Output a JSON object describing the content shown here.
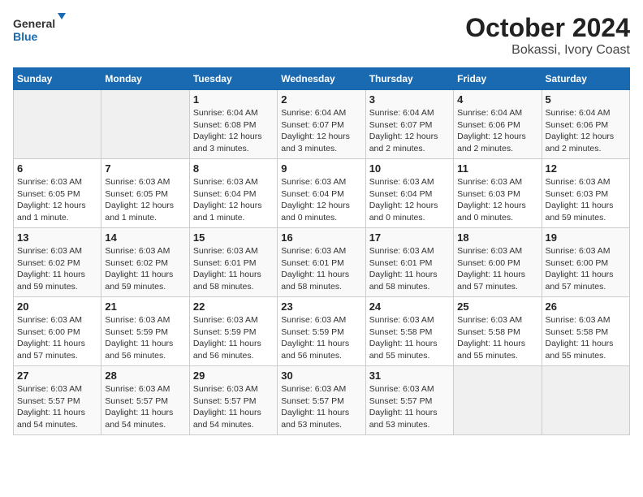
{
  "logo": {
    "text_general": "General",
    "text_blue": "Blue"
  },
  "title": "October 2024",
  "subtitle": "Bokassi, Ivory Coast",
  "header_days": [
    "Sunday",
    "Monday",
    "Tuesday",
    "Wednesday",
    "Thursday",
    "Friday",
    "Saturday"
  ],
  "weeks": [
    [
      {
        "day": "",
        "info": ""
      },
      {
        "day": "",
        "info": ""
      },
      {
        "day": "1",
        "info": "Sunrise: 6:04 AM\nSunset: 6:08 PM\nDaylight: 12 hours\nand 3 minutes."
      },
      {
        "day": "2",
        "info": "Sunrise: 6:04 AM\nSunset: 6:07 PM\nDaylight: 12 hours\nand 3 minutes."
      },
      {
        "day": "3",
        "info": "Sunrise: 6:04 AM\nSunset: 6:07 PM\nDaylight: 12 hours\nand 2 minutes."
      },
      {
        "day": "4",
        "info": "Sunrise: 6:04 AM\nSunset: 6:06 PM\nDaylight: 12 hours\nand 2 minutes."
      },
      {
        "day": "5",
        "info": "Sunrise: 6:04 AM\nSunset: 6:06 PM\nDaylight: 12 hours\nand 2 minutes."
      }
    ],
    [
      {
        "day": "6",
        "info": "Sunrise: 6:03 AM\nSunset: 6:05 PM\nDaylight: 12 hours\nand 1 minute."
      },
      {
        "day": "7",
        "info": "Sunrise: 6:03 AM\nSunset: 6:05 PM\nDaylight: 12 hours\nand 1 minute."
      },
      {
        "day": "8",
        "info": "Sunrise: 6:03 AM\nSunset: 6:04 PM\nDaylight: 12 hours\nand 1 minute."
      },
      {
        "day": "9",
        "info": "Sunrise: 6:03 AM\nSunset: 6:04 PM\nDaylight: 12 hours\nand 0 minutes."
      },
      {
        "day": "10",
        "info": "Sunrise: 6:03 AM\nSunset: 6:04 PM\nDaylight: 12 hours\nand 0 minutes."
      },
      {
        "day": "11",
        "info": "Sunrise: 6:03 AM\nSunset: 6:03 PM\nDaylight: 12 hours\nand 0 minutes."
      },
      {
        "day": "12",
        "info": "Sunrise: 6:03 AM\nSunset: 6:03 PM\nDaylight: 11 hours\nand 59 minutes."
      }
    ],
    [
      {
        "day": "13",
        "info": "Sunrise: 6:03 AM\nSunset: 6:02 PM\nDaylight: 11 hours\nand 59 minutes."
      },
      {
        "day": "14",
        "info": "Sunrise: 6:03 AM\nSunset: 6:02 PM\nDaylight: 11 hours\nand 59 minutes."
      },
      {
        "day": "15",
        "info": "Sunrise: 6:03 AM\nSunset: 6:01 PM\nDaylight: 11 hours\nand 58 minutes."
      },
      {
        "day": "16",
        "info": "Sunrise: 6:03 AM\nSunset: 6:01 PM\nDaylight: 11 hours\nand 58 minutes."
      },
      {
        "day": "17",
        "info": "Sunrise: 6:03 AM\nSunset: 6:01 PM\nDaylight: 11 hours\nand 58 minutes."
      },
      {
        "day": "18",
        "info": "Sunrise: 6:03 AM\nSunset: 6:00 PM\nDaylight: 11 hours\nand 57 minutes."
      },
      {
        "day": "19",
        "info": "Sunrise: 6:03 AM\nSunset: 6:00 PM\nDaylight: 11 hours\nand 57 minutes."
      }
    ],
    [
      {
        "day": "20",
        "info": "Sunrise: 6:03 AM\nSunset: 6:00 PM\nDaylight: 11 hours\nand 57 minutes."
      },
      {
        "day": "21",
        "info": "Sunrise: 6:03 AM\nSunset: 5:59 PM\nDaylight: 11 hours\nand 56 minutes."
      },
      {
        "day": "22",
        "info": "Sunrise: 6:03 AM\nSunset: 5:59 PM\nDaylight: 11 hours\nand 56 minutes."
      },
      {
        "day": "23",
        "info": "Sunrise: 6:03 AM\nSunset: 5:59 PM\nDaylight: 11 hours\nand 56 minutes."
      },
      {
        "day": "24",
        "info": "Sunrise: 6:03 AM\nSunset: 5:58 PM\nDaylight: 11 hours\nand 55 minutes."
      },
      {
        "day": "25",
        "info": "Sunrise: 6:03 AM\nSunset: 5:58 PM\nDaylight: 11 hours\nand 55 minutes."
      },
      {
        "day": "26",
        "info": "Sunrise: 6:03 AM\nSunset: 5:58 PM\nDaylight: 11 hours\nand 55 minutes."
      }
    ],
    [
      {
        "day": "27",
        "info": "Sunrise: 6:03 AM\nSunset: 5:57 PM\nDaylight: 11 hours\nand 54 minutes."
      },
      {
        "day": "28",
        "info": "Sunrise: 6:03 AM\nSunset: 5:57 PM\nDaylight: 11 hours\nand 54 minutes."
      },
      {
        "day": "29",
        "info": "Sunrise: 6:03 AM\nSunset: 5:57 PM\nDaylight: 11 hours\nand 54 minutes."
      },
      {
        "day": "30",
        "info": "Sunrise: 6:03 AM\nSunset: 5:57 PM\nDaylight: 11 hours\nand 53 minutes."
      },
      {
        "day": "31",
        "info": "Sunrise: 6:03 AM\nSunset: 5:57 PM\nDaylight: 11 hours\nand 53 minutes."
      },
      {
        "day": "",
        "info": ""
      },
      {
        "day": "",
        "info": ""
      }
    ]
  ]
}
